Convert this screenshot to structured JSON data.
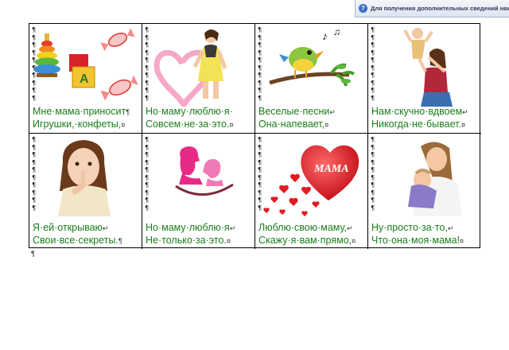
{
  "tooltip": {
    "text": "Для получения дополнительных сведений нажмите к"
  },
  "cells": [
    {
      "line1": "Мне·мама·приносит",
      "line1_mark": "¶",
      "line2": "Игрушки,·конфеты,",
      "line2_mark": "¤"
    },
    {
      "line1": "Но·маму·люблю·я·",
      "line1_mark": "",
      "line2": "Совсем·не·за·это.",
      "line2_mark": "¤"
    },
    {
      "line1": "Веселые·песни",
      "line1_mark": "↵",
      "line2": "Она·напевает,",
      "line2_mark": "¤"
    },
    {
      "line1": "Нам·скучно·вдвоем",
      "line1_mark": "↵",
      "line2": "Никогда·не·бывает.",
      "line2_mark": "¤"
    },
    {
      "line1": "Я·ей·открываю",
      "line1_mark": "↵",
      "line2": "Свои·все·секреты.",
      "line2_mark": "¶"
    },
    {
      "line1": "Но·маму·люблю·я",
      "line1_mark": "↵",
      "line2": "Не·только·за·это.",
      "line2_mark": "¤"
    },
    {
      "line1": "Люблю·свою·маму,",
      "line1_mark": "↵",
      "line2": "Скажу·я·вам·прямо,",
      "line2_mark": "¤"
    },
    {
      "line1": "Ну·просто·за·то,",
      "line1_mark": "↵",
      "line2": "Что·она·моя·мама!",
      "line2_mark": "¤"
    }
  ],
  "mama_heart_text": "MAMA",
  "toy_letter": "A",
  "pilcrow": "¶",
  "icons": [
    "toys-illustration",
    "mother-heart-illustration",
    "singing-bird-illustration",
    "mother-child-illustration",
    "girl-secret-illustration",
    "kiss-silhouette-illustration",
    "mama-heart-illustration",
    "mother-baby-illustration"
  ]
}
